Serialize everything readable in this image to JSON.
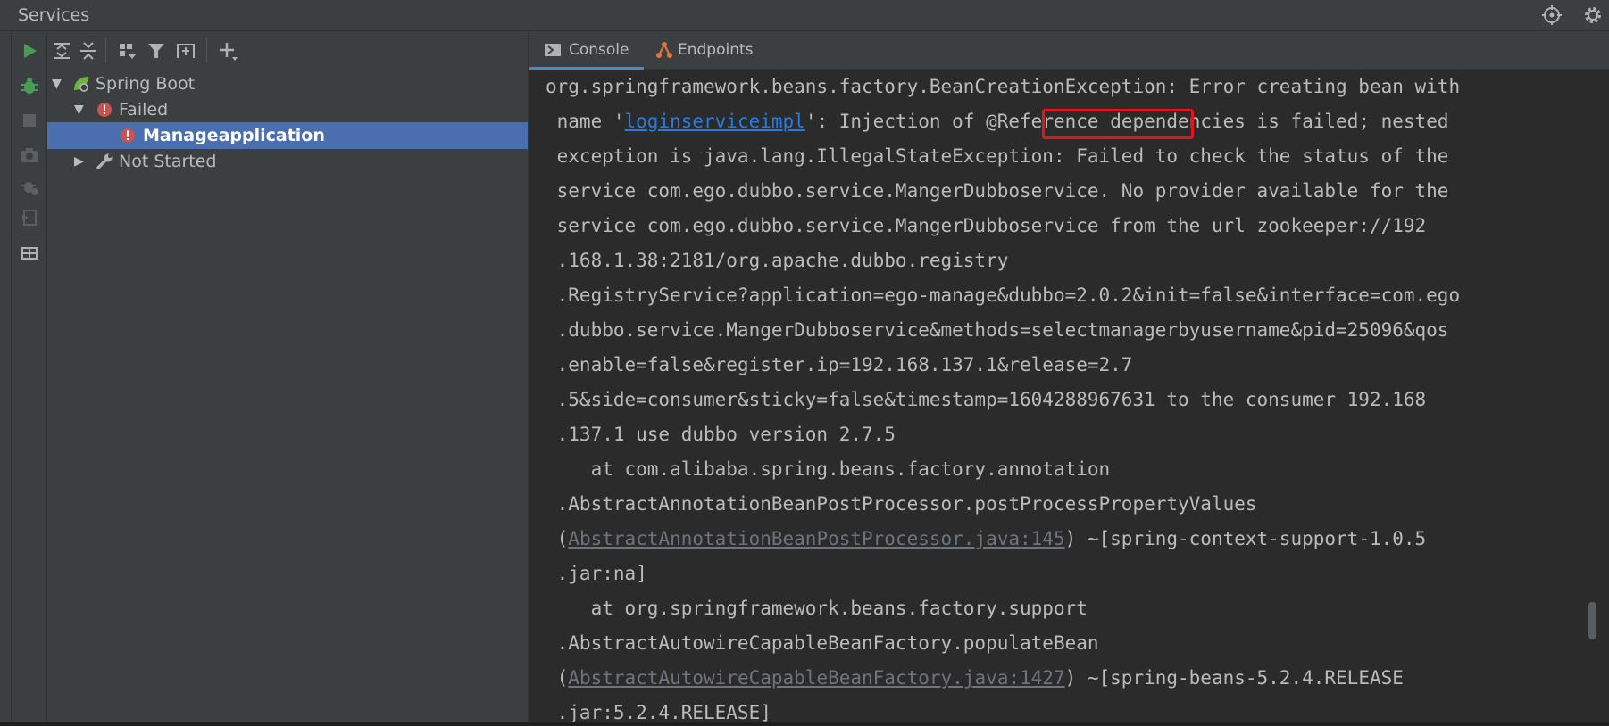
{
  "window": {
    "title": "Services"
  },
  "colors": {
    "accent": "#4b6eaf",
    "error": "#c75450",
    "run": "#499c54",
    "link": "#287bde",
    "highlight": "#e0161b"
  },
  "sidebar_tools": [
    "run-icon",
    "debug-icon",
    "stop-icon",
    "snapshot-icon",
    "bug-icon",
    "login-icon",
    "layout-icon"
  ],
  "tree_toolbar": [
    "expand-all-icon",
    "collapse-all-icon",
    "group-icon",
    "filter-icon",
    "new-tab-icon",
    "add-icon"
  ],
  "tree": {
    "spring_boot": "Spring Boot",
    "failed": "Failed",
    "selected": "Manageapplication",
    "not_started": "Not Started"
  },
  "tabs": {
    "console": "Console",
    "endpoints": "Endpoints"
  },
  "console": {
    "l1": "org.springframework.beans.factory.BeanCreationException: Error creating bean with",
    "l2a": " name '",
    "l2_link": "loginserviceimpl",
    "l2b": "': Injection of ",
    "l2_highlight": "@Reference",
    "l2c": " dependencies is failed; nested",
    "l3": " exception is java.lang.IllegalStateException: Failed to check the status of the",
    "l4": " service com.ego.dubbo.service.MangerDubboservice. No provider available for the",
    "l5": " service com.ego.dubbo.service.MangerDubboservice from the url zookeeper://192",
    "l6": " .168.1.38:2181/org.apache.dubbo.registry",
    "l7": " .RegistryService?application=ego-manage&dubbo=2.0.2&init=false&interface=com.ego",
    "l8": " .dubbo.service.MangerDubboservice&methods=selectmanagerbyusername&pid=25096&qos",
    "l9": " .enable=false&register.ip=192.168.137.1&release=2.7",
    "l10": " .5&side=consumer&sticky=false&timestamp=1604288967631 to the consumer 192.168",
    "l11": " .137.1 use dubbo version 2.7.5",
    "l12": "    at com.alibaba.spring.beans.factory.annotation",
    "l13": " .AbstractAnnotationBeanPostProcessor.postProcessPropertyValues",
    "l14a": " (",
    "l14_link": "AbstractAnnotationBeanPostProcessor.java:145",
    "l14b": ") ~[spring-context-support-1.0.5",
    "l15": " .jar:na]",
    "l16": "    at org.springframework.beans.factory.support",
    "l17": " .AbstractAutowireCapableBeanFactory.populateBean",
    "l18a": " (",
    "l18_link": "AbstractAutowireCapableBeanFactory.java:1427",
    "l18b": ") ~[spring-beans-5.2.4.RELEASE",
    "l19": " .jar:5.2.4.RELEASE]"
  }
}
